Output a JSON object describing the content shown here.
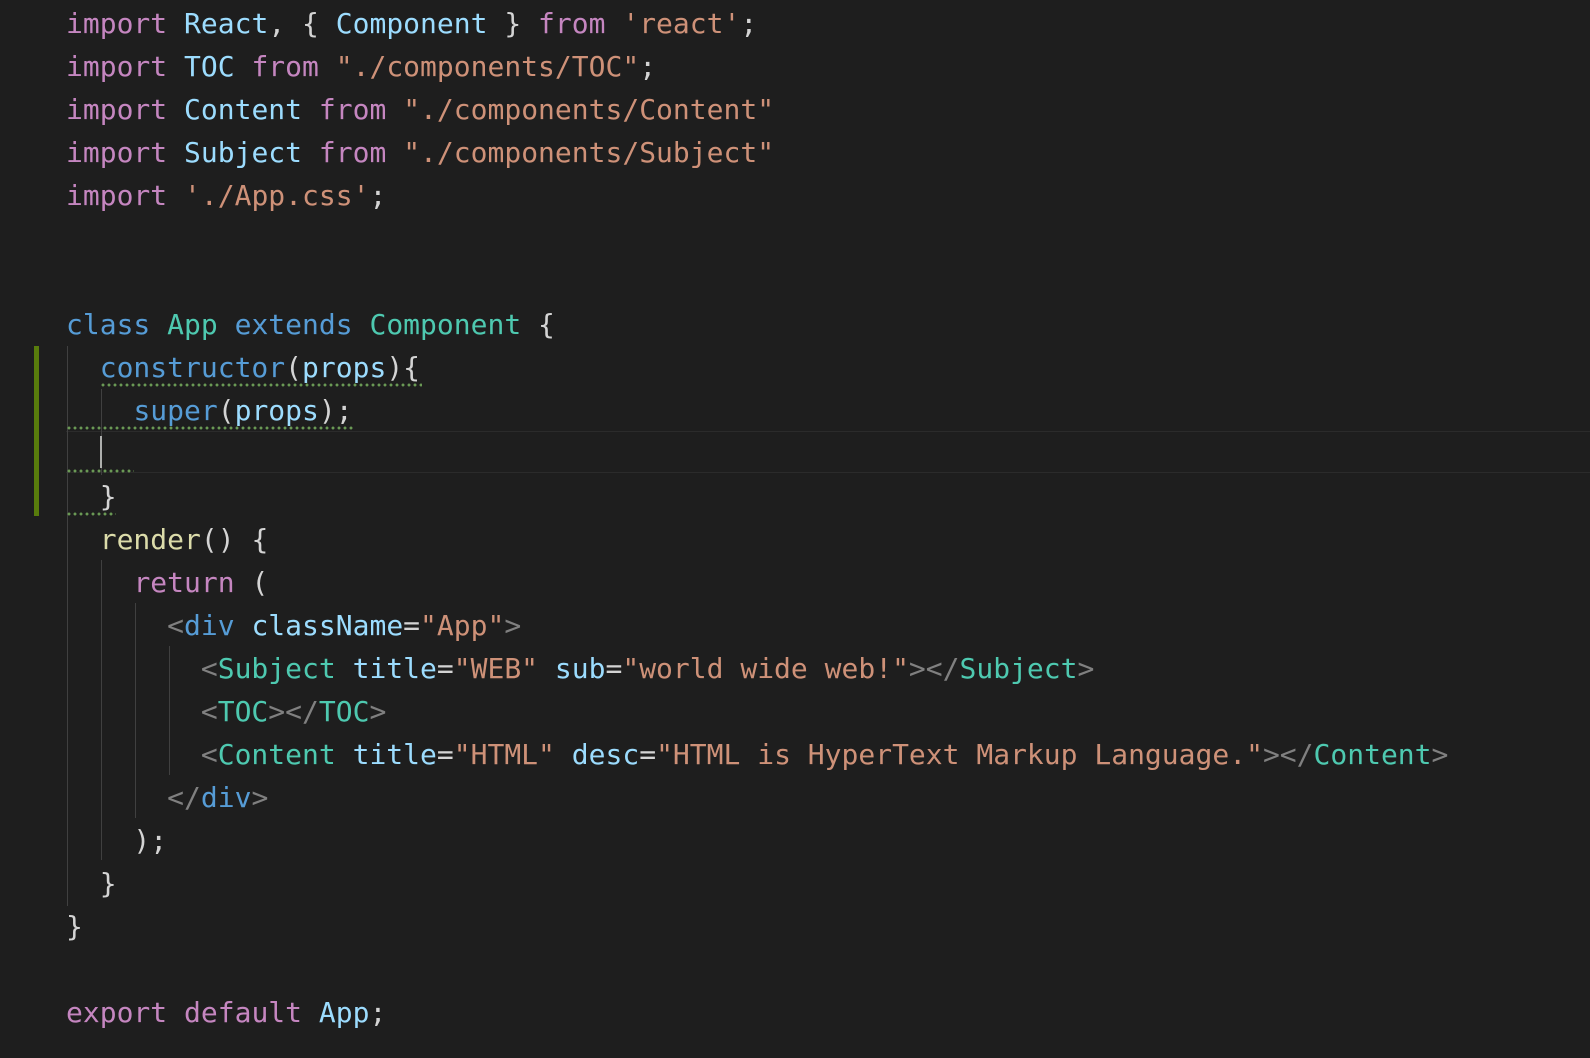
{
  "editor": {
    "language": "javascript",
    "colors": {
      "background": "#1e1e1e",
      "keyword_control": "#c586c0",
      "keyword_declaration": "#569cd6",
      "identifier": "#9cdcfe",
      "type": "#4ec9b0",
      "string": "#ce9178",
      "function": "#dcdcaa",
      "punctuation": "#d4d4d4",
      "jsx_tag_bracket": "#808080",
      "gutter_modified": "#587c0c",
      "squiggle": "#6a9955"
    },
    "lines": [
      {
        "tokens": [
          {
            "t": "import",
            "c": "kw-ctrl"
          },
          {
            "t": " ",
            "c": "punct"
          },
          {
            "t": "React",
            "c": "ident"
          },
          {
            "t": ", { ",
            "c": "punct"
          },
          {
            "t": "Component",
            "c": "ident"
          },
          {
            "t": " } ",
            "c": "punct"
          },
          {
            "t": "from",
            "c": "kw-ctrl"
          },
          {
            "t": " ",
            "c": "punct"
          },
          {
            "t": "'react'",
            "c": "str"
          },
          {
            "t": ";",
            "c": "punct"
          }
        ]
      },
      {
        "tokens": [
          {
            "t": "import",
            "c": "kw-ctrl"
          },
          {
            "t": " ",
            "c": "punct"
          },
          {
            "t": "TOC",
            "c": "ident"
          },
          {
            "t": " ",
            "c": "punct"
          },
          {
            "t": "from",
            "c": "kw-ctrl"
          },
          {
            "t": " ",
            "c": "punct"
          },
          {
            "t": "\"./components/TOC\"",
            "c": "str"
          },
          {
            "t": ";",
            "c": "punct"
          }
        ]
      },
      {
        "tokens": [
          {
            "t": "import",
            "c": "kw-ctrl"
          },
          {
            "t": " ",
            "c": "punct"
          },
          {
            "t": "Content",
            "c": "ident"
          },
          {
            "t": " ",
            "c": "punct"
          },
          {
            "t": "from",
            "c": "kw-ctrl"
          },
          {
            "t": " ",
            "c": "punct"
          },
          {
            "t": "\"./components/Content\"",
            "c": "str"
          }
        ]
      },
      {
        "tokens": [
          {
            "t": "import",
            "c": "kw-ctrl"
          },
          {
            "t": " ",
            "c": "punct"
          },
          {
            "t": "Subject",
            "c": "ident"
          },
          {
            "t": " ",
            "c": "punct"
          },
          {
            "t": "from",
            "c": "kw-ctrl"
          },
          {
            "t": " ",
            "c": "punct"
          },
          {
            "t": "\"./components/Subject\"",
            "c": "str"
          }
        ]
      },
      {
        "tokens": [
          {
            "t": "import",
            "c": "kw-ctrl"
          },
          {
            "t": " ",
            "c": "punct"
          },
          {
            "t": "'./App.css'",
            "c": "str"
          },
          {
            "t": ";",
            "c": "punct"
          }
        ]
      },
      {
        "tokens": []
      },
      {
        "tokens": []
      },
      {
        "tokens": [
          {
            "t": "class",
            "c": "kw-decl"
          },
          {
            "t": " ",
            "c": "punct"
          },
          {
            "t": "App",
            "c": "type"
          },
          {
            "t": " ",
            "c": "punct"
          },
          {
            "t": "extends",
            "c": "kw-decl"
          },
          {
            "t": " ",
            "c": "punct"
          },
          {
            "t": "Component",
            "c": "type"
          },
          {
            "t": " {",
            "c": "punct"
          }
        ]
      },
      {
        "tokens": [
          {
            "t": "  ",
            "c": "punct"
          },
          {
            "t": "constructor",
            "c": "kw-decl"
          },
          {
            "t": "(",
            "c": "punct"
          },
          {
            "t": "props",
            "c": "ident"
          },
          {
            "t": "){",
            "c": "punct"
          }
        ]
      },
      {
        "tokens": [
          {
            "t": "    ",
            "c": "punct"
          },
          {
            "t": "super",
            "c": "kw-decl"
          },
          {
            "t": "(",
            "c": "punct"
          },
          {
            "t": "props",
            "c": "ident"
          },
          {
            "t": ");",
            "c": "punct"
          }
        ]
      },
      {
        "tokens": []
      },
      {
        "tokens": [
          {
            "t": "  }",
            "c": "punct"
          }
        ]
      },
      {
        "tokens": [
          {
            "t": "  ",
            "c": "punct"
          },
          {
            "t": "render",
            "c": "func"
          },
          {
            "t": "() {",
            "c": "punct"
          }
        ]
      },
      {
        "tokens": [
          {
            "t": "    ",
            "c": "punct"
          },
          {
            "t": "return",
            "c": "kw-ctrl"
          },
          {
            "t": " (",
            "c": "punct"
          }
        ]
      },
      {
        "tokens": [
          {
            "t": "      ",
            "c": "punct"
          },
          {
            "t": "<",
            "c": "tagp"
          },
          {
            "t": "div",
            "c": "kw-decl"
          },
          {
            "t": " ",
            "c": "punct"
          },
          {
            "t": "className",
            "c": "attr"
          },
          {
            "t": "=",
            "c": "punct"
          },
          {
            "t": "\"App\"",
            "c": "str"
          },
          {
            "t": ">",
            "c": "tagp"
          }
        ]
      },
      {
        "tokens": [
          {
            "t": "        ",
            "c": "punct"
          },
          {
            "t": "<",
            "c": "tagp"
          },
          {
            "t": "Subject",
            "c": "type"
          },
          {
            "t": " ",
            "c": "punct"
          },
          {
            "t": "title",
            "c": "attr"
          },
          {
            "t": "=",
            "c": "punct"
          },
          {
            "t": "\"WEB\"",
            "c": "str"
          },
          {
            "t": " ",
            "c": "punct"
          },
          {
            "t": "sub",
            "c": "attr"
          },
          {
            "t": "=",
            "c": "punct"
          },
          {
            "t": "\"world wide web!\"",
            "c": "str"
          },
          {
            "t": "></",
            "c": "tagp"
          },
          {
            "t": "Subject",
            "c": "type"
          },
          {
            "t": ">",
            "c": "tagp"
          }
        ]
      },
      {
        "tokens": [
          {
            "t": "        ",
            "c": "punct"
          },
          {
            "t": "<",
            "c": "tagp"
          },
          {
            "t": "TOC",
            "c": "type"
          },
          {
            "t": "></",
            "c": "tagp"
          },
          {
            "t": "TOC",
            "c": "type"
          },
          {
            "t": ">",
            "c": "tagp"
          }
        ]
      },
      {
        "tokens": [
          {
            "t": "        ",
            "c": "punct"
          },
          {
            "t": "<",
            "c": "tagp"
          },
          {
            "t": "Content",
            "c": "type"
          },
          {
            "t": " ",
            "c": "punct"
          },
          {
            "t": "title",
            "c": "attr"
          },
          {
            "t": "=",
            "c": "punct"
          },
          {
            "t": "\"HTML\"",
            "c": "str"
          },
          {
            "t": " ",
            "c": "punct"
          },
          {
            "t": "desc",
            "c": "attr"
          },
          {
            "t": "=",
            "c": "punct"
          },
          {
            "t": "\"HTML is HyperText Markup Language.\"",
            "c": "str"
          },
          {
            "t": "></",
            "c": "tagp"
          },
          {
            "t": "Content",
            "c": "type"
          },
          {
            "t": ">",
            "c": "tagp"
          }
        ]
      },
      {
        "tokens": [
          {
            "t": "      ",
            "c": "punct"
          },
          {
            "t": "</",
            "c": "tagp"
          },
          {
            "t": "div",
            "c": "kw-decl"
          },
          {
            "t": ">",
            "c": "tagp"
          }
        ]
      },
      {
        "tokens": [
          {
            "t": "    );",
            "c": "punct"
          }
        ]
      },
      {
        "tokens": [
          {
            "t": "  }",
            "c": "punct"
          }
        ]
      },
      {
        "tokens": [
          {
            "t": "}",
            "c": "punct"
          }
        ]
      },
      {
        "tokens": []
      },
      {
        "tokens": [
          {
            "t": "export",
            "c": "kw-ctrl"
          },
          {
            "t": " ",
            "c": "punct"
          },
          {
            "t": "default",
            "c": "kw-ctrl"
          },
          {
            "t": " ",
            "c": "punct"
          },
          {
            "t": "App",
            "c": "ident"
          },
          {
            "t": ";",
            "c": "punct"
          }
        ]
      }
    ]
  }
}
